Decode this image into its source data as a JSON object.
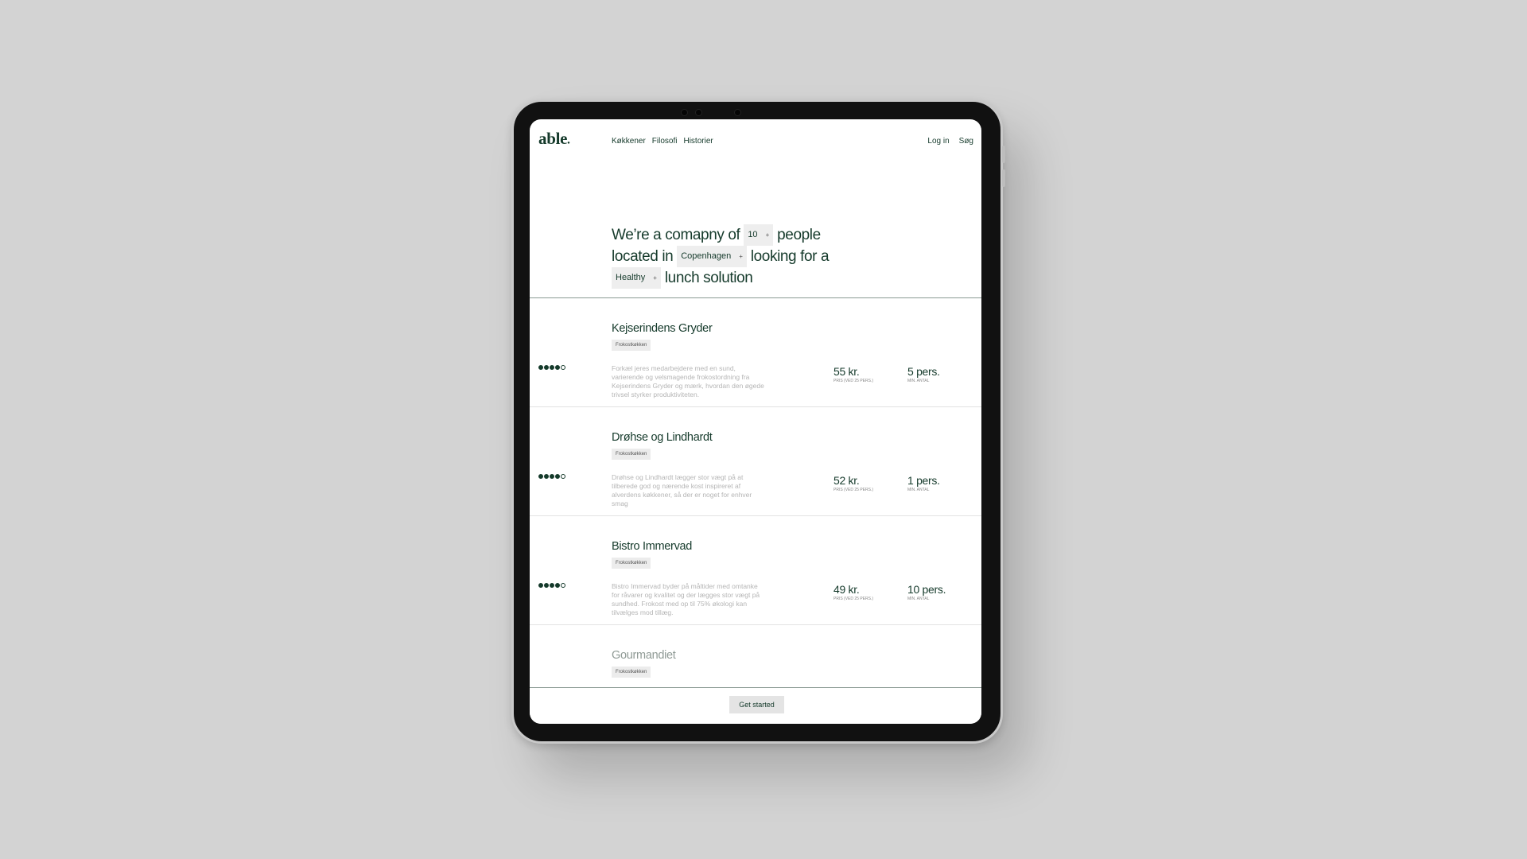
{
  "brand": {
    "logo_text": "able",
    "logo_mark": "●"
  },
  "nav": {
    "left": [
      "Køkkener",
      "Filosofi",
      "Historier"
    ],
    "right": [
      "Log in",
      "Søg"
    ]
  },
  "hero": {
    "part1": "We’re a comapny of",
    "people_count": "10",
    "part2": "people",
    "part3": "located in",
    "city": "Copenhagen",
    "part4": "looking for a",
    "food_type": "Healthy",
    "part5": "lunch solution",
    "dropdown_icon": "+"
  },
  "listings": [
    {
      "name": "Kejserindens Gryder",
      "tag": "Frokostkøkken",
      "rating": 4,
      "rating_max": 5,
      "description": "Forkæl jeres medarbejdere med en sund, varierende og velsmagende frokostordning fra Kejserindens Gryder og mærk, hvordan den øgede trivsel styrker produktiviteten.",
      "price": "55 kr.",
      "price_label": "PRIS (VED 25 PERS.)",
      "persons": "5 pers.",
      "persons_label": "MIN. ANTAL"
    },
    {
      "name": "Drøhse og Lindhardt",
      "tag": "Frokostkøkken",
      "rating": 4,
      "rating_max": 5,
      "description": "Drøhse og Lindhardt lægger stor vægt på at tilberede god og nærende kost inspireret af alverdens køkkener, så der er noget for enhver smag",
      "price": "52 kr.",
      "price_label": "PRIS (VED 25 PERS.)",
      "persons": "1 pers.",
      "persons_label": "MIN. ANTAL"
    },
    {
      "name": "Bistro Immervad",
      "tag": "Frokostkøkken",
      "rating": 4,
      "rating_max": 5,
      "description": "Bistro Immervad byder på måltider med omtanke for råvarer og kvalitet og der lægges stor vægt på sundhed. Frokost med op til 75% økologi kan tilvælges mod tillæg.",
      "price": "49 kr.",
      "price_label": "PRIS (VED 25 PERS.)",
      "persons": "10 pers.",
      "persons_label": "MIN. ANTAL"
    },
    {
      "name": "Gourmandiet",
      "tag": "Frokostkøkken"
    }
  ],
  "cta": {
    "label": "Get started"
  }
}
